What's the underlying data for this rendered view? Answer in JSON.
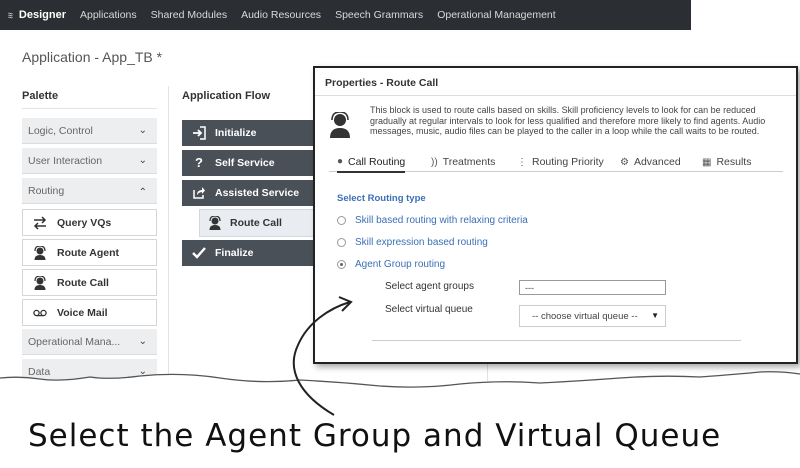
{
  "nav": {
    "brand": "Designer",
    "items": [
      "Applications",
      "Shared Modules",
      "Audio Resources",
      "Speech Grammars",
      "Operational Management"
    ]
  },
  "page": {
    "title": "Application - App_TB *"
  },
  "palette": {
    "heading": "Palette",
    "categories": {
      "logic": "Logic, Control",
      "user_interaction": "User Interaction",
      "routing": "Routing",
      "operational": "Operational Mana...",
      "data": "Data"
    },
    "items": {
      "query_vqs": "Query VQs",
      "route_agent": "Route Agent",
      "route_call": "Route Call",
      "voice_mail": "Voice Mail"
    }
  },
  "flow": {
    "heading": "Application Flow",
    "rows": {
      "initialize": "Initialize",
      "self_service": "Self Service",
      "assisted_service": "Assisted Service",
      "route_call": "Route Call",
      "finalize": "Finalize"
    }
  },
  "properties": {
    "title": "Properties - Route Call",
    "description": "This block is used to route calls based on skills. Skill proficiency levels to look for can be reduced gradually at regular intervals to look for less qualified and therefore more likely to find agents. Audio messages, music, audio files can be played to the caller in a loop while the call waits to be routed.",
    "tabs": {
      "call_routing": "Call Routing",
      "treatments": "Treatments",
      "routing_priority": "Routing Priority",
      "advanced": "Advanced",
      "results": "Results"
    },
    "select_routing_type": "Select Routing type",
    "options": {
      "skill_relaxing": "Skill based routing with relaxing criteria",
      "skill_expression": "Skill expression based routing",
      "agent_group": "Agent Group routing"
    },
    "selected_option": "agent_group",
    "agent_groups_label": "Select agent groups",
    "agent_groups_value": "---",
    "virtual_queue_label": "Select virtual queue",
    "virtual_queue_value": "-- choose virtual queue --"
  },
  "caption": "Select the Agent Group and Virtual Queue"
}
